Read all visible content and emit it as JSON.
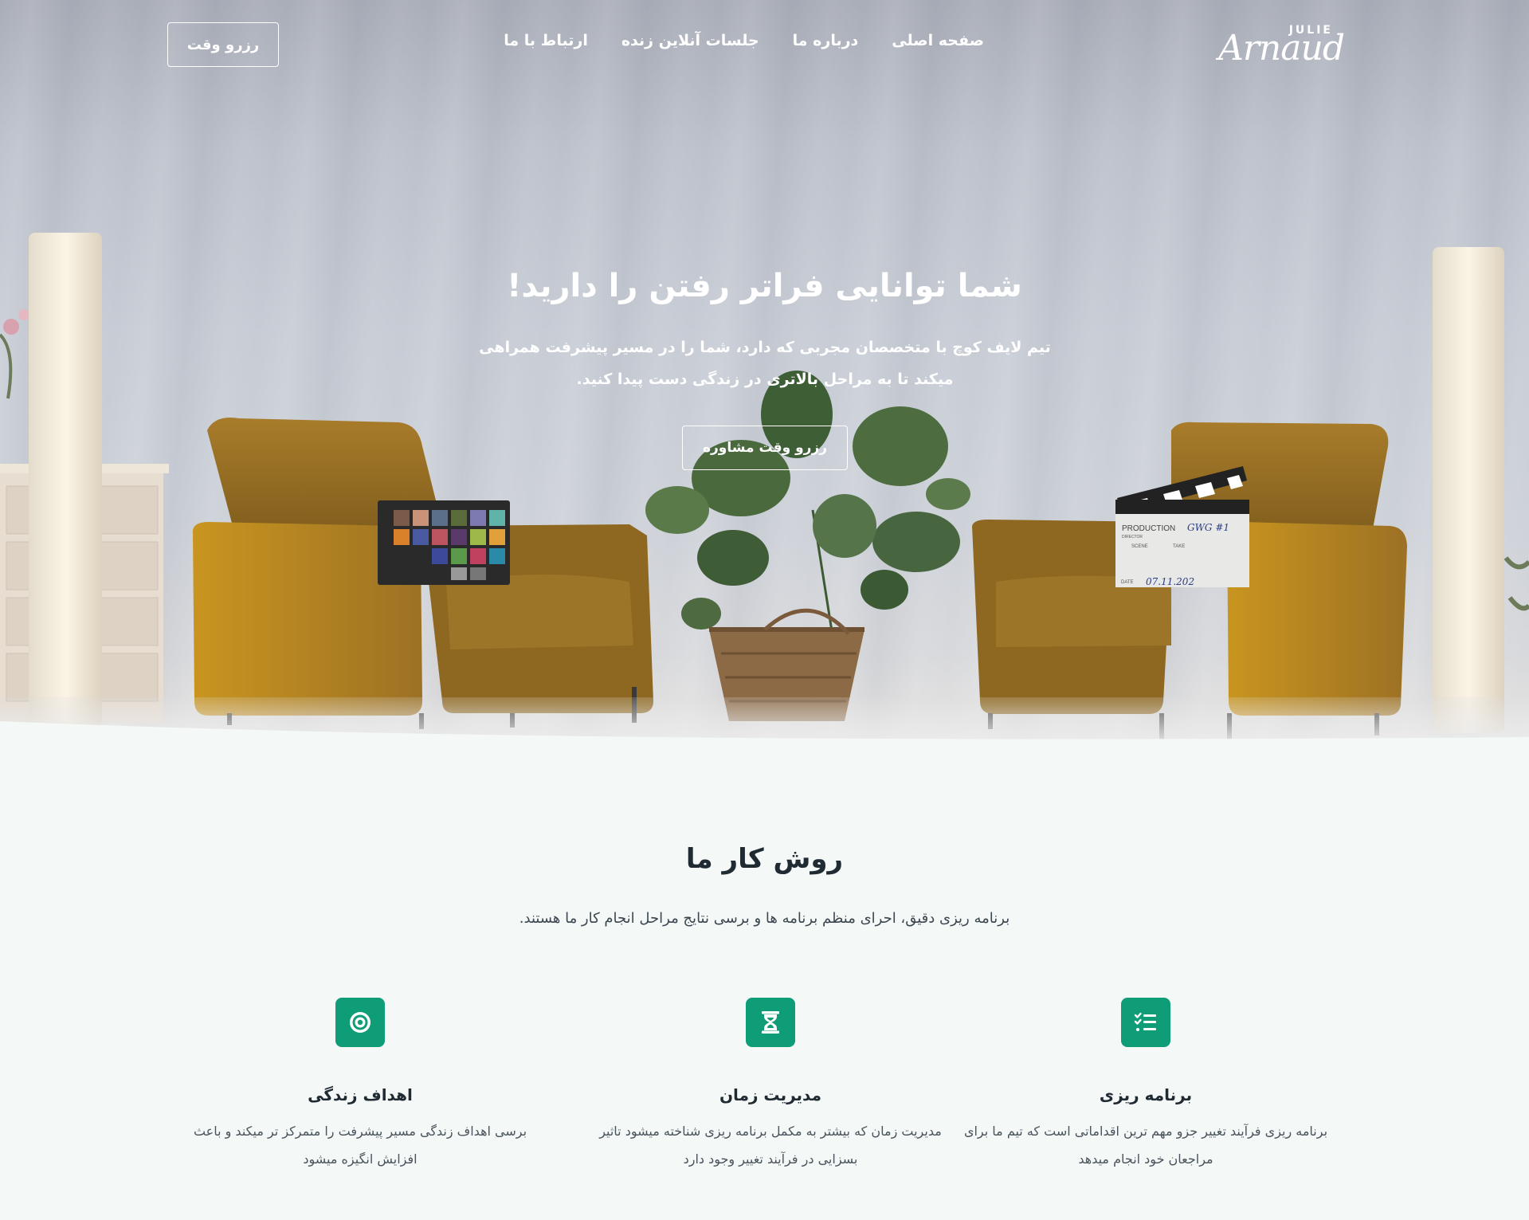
{
  "nav": {
    "logo_small": "JULIE",
    "logo_script": "Arnaud",
    "links": [
      "صفحه اصلی",
      "درباره ما",
      "جلسات آنلاین زنده",
      "ارتباط با ما"
    ],
    "cta": "رزرو وقت"
  },
  "hero": {
    "title": "شما توانایی فراتر رفتن را دارید!",
    "subtitle": "تیم لایف کوچ با متخصصان مجربی که دارد، شما را در مسیر پیشرفت همراهی میکند تا به مراحل بالاتری در زندگی دست پیدا کنید.",
    "button": "رزرو وقت مشاوره",
    "props": {
      "clapper_line1": "PRODUCTION",
      "clapper_line2": "GWG #1",
      "clapper_director": "DIRECTOR",
      "clapper_scene": "SCENE",
      "clapper_take": "TAKE",
      "clapper_date": "DATE",
      "clapper_date_value": "07.11.202"
    }
  },
  "section": {
    "title": "روش کار ما",
    "subtitle": "برنامه ریزی دقیق، احرای منظم برنامه ها و برسی نتایج مراحل انجام کار ما هستند."
  },
  "features": [
    {
      "icon": "list-check-icon",
      "title": "برنامه ریزی",
      "text": "برنامه ریزی فرآیند تغییر جزو مهم ترین اقداماتی است که تیم ما برای مراجعان خود انجام میدهد"
    },
    {
      "icon": "hourglass-icon",
      "title": "مدیریت زمان",
      "text": "مدیریت زمان که بیشتر به مکمل برنامه ریزی شناخته میشود تاثیر بسزایی در فرآیند تغییر وجود دارد"
    },
    {
      "icon": "target-icon",
      "title": "اهداف زندگی",
      "text": "برسی اهداف زندگی مسیر پیشرفت را متمرکز تر میکند و باعث افزایش انگیزه میشود"
    }
  ],
  "colors": {
    "accent": "#0f9d77",
    "armchair": "#b98a2c",
    "background": "#f4f8f7"
  }
}
